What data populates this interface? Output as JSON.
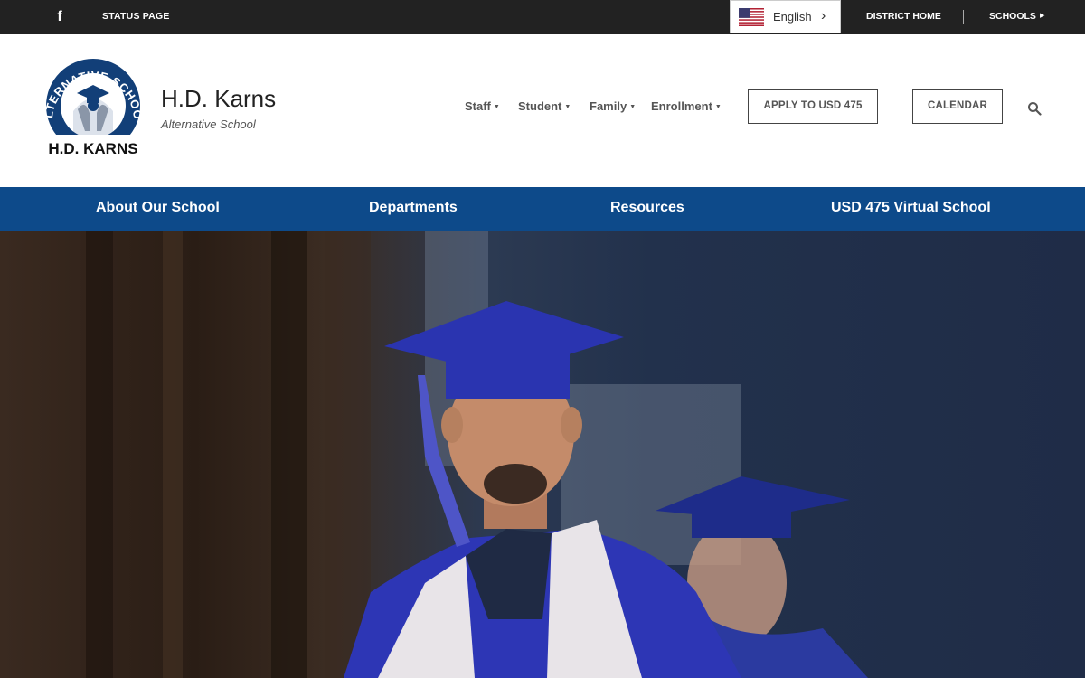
{
  "topbar": {
    "facebook_icon": "facebook-icon",
    "status_page": "STATUS PAGE",
    "language": "English",
    "district_home": "DISTRICT HOME",
    "schools": "SCHOOLS"
  },
  "header": {
    "logo_text_top": "ALTERNATIVE SCHOOL",
    "logo_text_bottom": "H.D. KARNS",
    "school_name": "H.D. Karns",
    "school_subtitle": "Alternative School",
    "menu": [
      {
        "label": "Staff"
      },
      {
        "label": "Student"
      },
      {
        "label": "Family"
      },
      {
        "label": "Enrollment"
      }
    ],
    "apply_button": "APPLY TO USD 475",
    "calendar_button": "CALENDAR",
    "search_icon": "search-icon"
  },
  "nav": {
    "items": [
      {
        "label": "About Our School"
      },
      {
        "label": "Departments"
      },
      {
        "label": "Resources"
      },
      {
        "label": "USD 475 Virtual School"
      }
    ]
  },
  "colors": {
    "topbar_bg": "#222222",
    "nav_bg": "#0d4a8a",
    "accent_blue": "#123f78"
  }
}
